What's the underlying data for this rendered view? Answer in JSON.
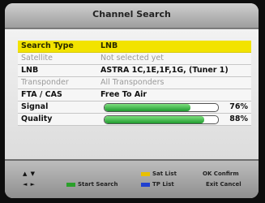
{
  "header": {
    "title": "Channel Search"
  },
  "rows": [
    {
      "label": "Search Type",
      "value": "LNB"
    },
    {
      "label": "Satellite",
      "value": "Not selected yet"
    },
    {
      "label": "LNB",
      "value": "ASTRA 1C,1E,1F,1G, (Tuner  1)"
    },
    {
      "label": "Transponder",
      "value": "All Transponders"
    },
    {
      "label": "FTA / CAS",
      "value": "Free To Air"
    }
  ],
  "signal": {
    "label": "Signal",
    "percent_text": "76%",
    "level": 0.76
  },
  "quality": {
    "label": "Quality",
    "percent_text": "88%",
    "level": 0.88
  },
  "footer": {
    "nav_updown": "▲ ▼",
    "nav_leftright": "◄ ►",
    "green_label": "Start Search",
    "yellow_label": "Sat List",
    "blue_label": "TP List",
    "ok_label": "OK Confirm",
    "exit_label": "Exit Cancel"
  },
  "colors": {
    "selected_row": "#f2e300",
    "green_key": "#2aa02a",
    "yellow_key": "#e8c000",
    "blue_key": "#2040d0",
    "bar_fill": "#3fbf4f"
  }
}
